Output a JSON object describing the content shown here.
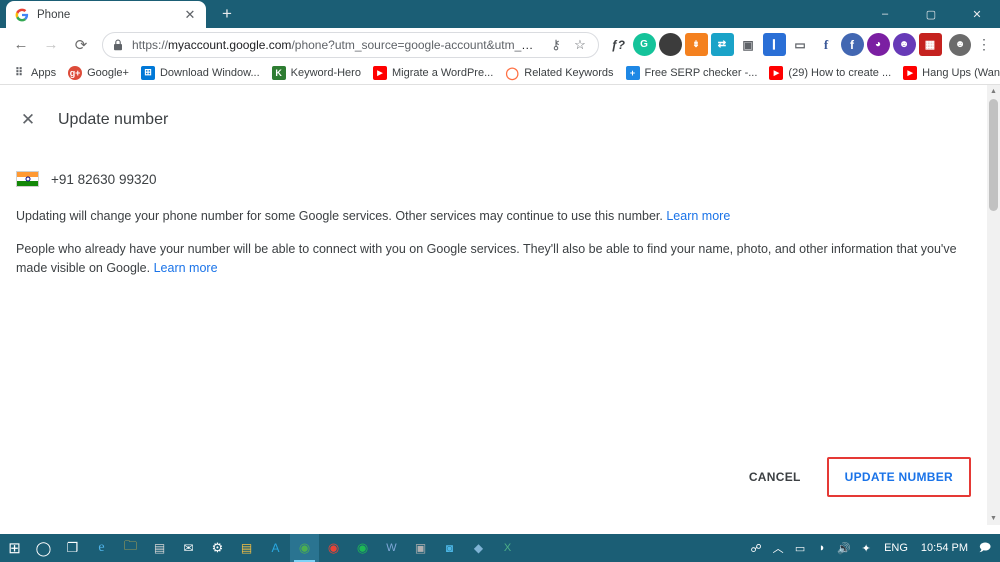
{
  "browser": {
    "tab": {
      "title": "Phone",
      "favicon_icon": "google-g-icon",
      "close_icon": "close-icon"
    },
    "new_tab_icon": "plus-icon",
    "window_controls": {
      "minimize": "–",
      "maximize": "▢",
      "close": "✕"
    },
    "nav": {
      "back_icon": "arrow-left-icon",
      "forward_icon": "arrow-right-icon",
      "reload_icon": "reload-icon"
    },
    "omnibox": {
      "lock_icon": "lock-icon",
      "url_prefix": "https://",
      "url_domain": "myaccount.google.com",
      "url_path": "/phone?utm_source=google-account&utm_medium=we...",
      "key_icon": "key-icon",
      "star_icon": "star-icon"
    },
    "extensions": [
      {
        "name": "italic-f-extension",
        "glyph": "ƒ?",
        "color": "#ffffff",
        "fg": "#3c4043"
      },
      {
        "name": "grammarly-extension",
        "glyph": "G",
        "color": "#15c39a",
        "fg": "#ffffff"
      },
      {
        "name": "dark-circle-extension",
        "glyph": "",
        "color": "#3c3c3c",
        "fg": "#ffffff"
      },
      {
        "name": "orange-extension",
        "glyph": "⎙",
        "color": "#f4811f",
        "fg": "#ffffff"
      },
      {
        "name": "teal-sync-extension",
        "glyph": "⇄",
        "color": "#1aa3c8",
        "fg": "#ffffff"
      },
      {
        "name": "camera-extension",
        "glyph": "▣",
        "color": "#dadce0",
        "fg": "#5f6368"
      },
      {
        "name": "blue-bar-extension",
        "glyph": "❙",
        "color": "#2a6fd6",
        "fg": "#ffffff"
      },
      {
        "name": "screenshot-extension",
        "glyph": "▭",
        "color": "#9aa0a6",
        "fg": "#ffffff"
      },
      {
        "name": "facebook-extension",
        "glyph": "f",
        "color": "#3b5998",
        "fg": "#ffffff"
      },
      {
        "name": "fb-blue-extension",
        "glyph": "f",
        "color": "#4267b2",
        "fg": "#ffffff"
      },
      {
        "name": "ghost-extension",
        "glyph": "◕",
        "color": "#7b1fa2",
        "fg": "#ffffff"
      },
      {
        "name": "person-extension",
        "glyph": "☻",
        "color": "#673ab7",
        "fg": "#ffffff"
      },
      {
        "name": "red-grid-extension",
        "glyph": "▦",
        "color": "#c5221f",
        "fg": "#ffffff"
      }
    ],
    "profile_avatar": "user-avatar",
    "menu_icon": "three-dots-menu-icon",
    "bookmarks": [
      {
        "label": "Apps",
        "icon": "apps-grid-icon",
        "color": "#4285f4"
      },
      {
        "label": "Google+",
        "icon": "google-plus-icon",
        "color": "#dd4b39"
      },
      {
        "label": "Download Window...",
        "icon": "windows-icon",
        "color": "#0078d7"
      },
      {
        "label": "Keyword-Hero",
        "icon": "keyword-hero-icon",
        "color": "#2e7d32"
      },
      {
        "label": "Migrate a WordPre...",
        "icon": "youtube-icon",
        "color": "#ff0000"
      },
      {
        "label": "Related Keywords",
        "icon": "circle-icon",
        "color": "#ff7043"
      },
      {
        "label": "Free SERP checker -...",
        "icon": "serp-icon",
        "color": "#1e88e5"
      },
      {
        "label": "(29) How to create ...",
        "icon": "youtube-icon",
        "color": "#ff0000"
      },
      {
        "label": "Hang Ups (Want Yo...",
        "icon": "youtube-icon",
        "color": "#ff0000"
      }
    ],
    "bookmarks_overflow_icon": "chevron-double-right-icon"
  },
  "page": {
    "close_icon": "close-icon",
    "title": "Update number",
    "phone": {
      "flag_icon": "india-flag-icon",
      "number": "+91 82630 99320"
    },
    "paragraph1": {
      "text": "Updating will change your phone number for some Google services. Other services may continue to use this number.",
      "link": "Learn more"
    },
    "paragraph2": {
      "text": "People who already have your number will be able to connect with you on Google services. They'll also be able to find your name, photo, and other information that you've made visible on Google.",
      "link": "Learn more"
    },
    "actions": {
      "cancel_label": "CANCEL",
      "update_label": "UPDATE NUMBER",
      "highlight_color": "#e53935",
      "accent_color": "#1a73e8"
    }
  },
  "taskbar": {
    "items": [
      {
        "name": "start-button",
        "glyph": "⊞",
        "color": "#ffffff",
        "active": false
      },
      {
        "name": "cortana-search",
        "glyph": "◯",
        "color": "#ffffff",
        "active": false
      },
      {
        "name": "task-view",
        "glyph": "❐",
        "color": "#ffffff",
        "active": false
      },
      {
        "name": "edge-browser",
        "glyph": "e",
        "color": "#2e8ce0",
        "active": false
      },
      {
        "name": "file-explorer",
        "glyph": "🗀",
        "color": "#ffc83d",
        "active": false
      },
      {
        "name": "store",
        "glyph": "▤",
        "color": "#d7d7d7",
        "active": false
      },
      {
        "name": "mail",
        "glyph": "✉",
        "color": "#ffffff",
        "active": false
      },
      {
        "name": "settings",
        "glyph": "⚙",
        "color": "#ffffff",
        "active": false
      },
      {
        "name": "notepad",
        "glyph": "▤",
        "color": "#f5c043",
        "active": false
      },
      {
        "name": "adobe-app",
        "glyph": "A",
        "color": "#2aa8e0",
        "active": false
      },
      {
        "name": "chrome-browser",
        "glyph": "◉",
        "color": "#4caf50",
        "active": true
      },
      {
        "name": "chrome-browser-2",
        "glyph": "◉",
        "color": "#ea4335",
        "active": false
      },
      {
        "name": "spotify",
        "glyph": "◉",
        "color": "#1db954",
        "active": false
      },
      {
        "name": "word-app",
        "glyph": "W",
        "color": "#2b579a",
        "active": false
      },
      {
        "name": "photos-app",
        "glyph": "▣",
        "color": "#8a8a8a",
        "active": false
      },
      {
        "name": "instagram-app",
        "glyph": "◙",
        "color": "#4db8e8",
        "active": false
      },
      {
        "name": "unknown-app",
        "glyph": "◆",
        "color": "#7fb3d5",
        "active": false
      },
      {
        "name": "excel-app",
        "glyph": "X",
        "color": "#1d6f42",
        "active": false
      }
    ],
    "tray": [
      {
        "name": "people-icon",
        "glyph": "👤"
      },
      {
        "name": "show-hidden-icons",
        "glyph": "︿"
      },
      {
        "name": "battery-icon",
        "glyph": "▭"
      },
      {
        "name": "wifi-icon",
        "glyph": "◗"
      },
      {
        "name": "volume-icon",
        "glyph": "🔊"
      },
      {
        "name": "bluetooth-icon",
        "glyph": "✦"
      }
    ],
    "language": "ENG",
    "clock": "10:54 PM",
    "notification_icon": "notification-icon"
  }
}
